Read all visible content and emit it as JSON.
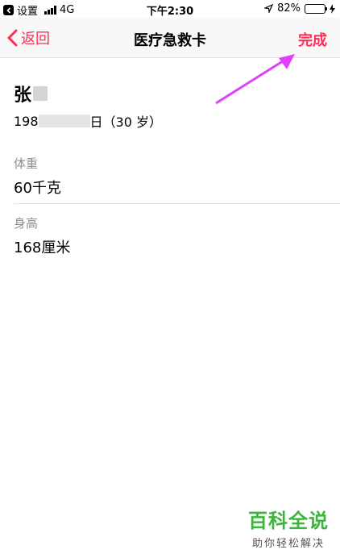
{
  "status_bar": {
    "back_app_label": "设置",
    "network": "4G",
    "time": "下午2:30",
    "battery_percent": "82%",
    "battery_level": 0.82
  },
  "nav": {
    "back_label": "返回",
    "title": "医疗急救卡",
    "done_label": "完成"
  },
  "profile": {
    "name_visible": "张",
    "birth_visible_prefix": "198",
    "birth_visible_suffix": "日（30 岁）"
  },
  "fields": [
    {
      "label": "体重",
      "value": "60千克"
    },
    {
      "label": "身高",
      "value": "168厘米"
    }
  ],
  "watermark": {
    "main": "百科全说",
    "sub": "助你轻松解决"
  },
  "colors": {
    "accent": "#ff2d55",
    "arrow": "#e040fb",
    "watermark": "#3db43d"
  }
}
